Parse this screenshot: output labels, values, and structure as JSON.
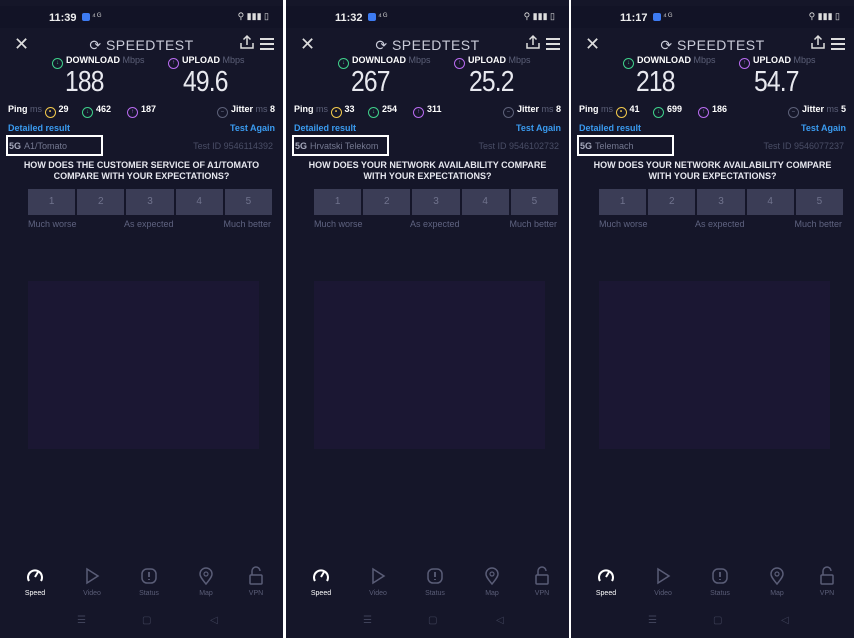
{
  "app": {
    "name": "SPEEDTEST"
  },
  "labels": {
    "download": "DOWNLOAD",
    "upload": "UPLOAD",
    "mbps": "Mbps",
    "ping": "Ping",
    "ms": "ms",
    "jitter": "Jitter",
    "detailed": "Detailed result",
    "again": "Test Again",
    "network": "5G",
    "rating": [
      "1",
      "2",
      "3",
      "4",
      "5"
    ],
    "scale": [
      "Much worse",
      "As expected",
      "Much better"
    ]
  },
  "nav": [
    "Speed",
    "Video",
    "Status",
    "Map",
    "VPN"
  ],
  "screens": [
    {
      "time": "11:39",
      "download": "188",
      "upload": "49.6",
      "ping": "29",
      "ping_dl": "462",
      "ping_ul": "187",
      "jitter": "8",
      "provider": "A1/Tomato",
      "test_id": "Test ID 9546114392",
      "question": "HOW DOES THE CUSTOMER SERVICE OF A1/TOMATO COMPARE WITH YOUR EXPECTATIONS?"
    },
    {
      "time": "11:32",
      "download": "267",
      "upload": "25.2",
      "ping": "33",
      "ping_dl": "254",
      "ping_ul": "311",
      "jitter": "8",
      "provider": "Hrvatski Telekom",
      "test_id": "Test ID 9546102732",
      "question": "HOW DOES YOUR NETWORK AVAILABILITY COMPARE WITH YOUR EXPECTATIONS?"
    },
    {
      "time": "11:17",
      "download": "218",
      "upload": "54.7",
      "ping": "41",
      "ping_dl": "699",
      "ping_ul": "186",
      "jitter": "5",
      "provider": "Telemach",
      "test_id": "Test ID 9546077237",
      "question": "HOW DOES YOUR NETWORK AVAILABILITY COMPARE WITH YOUR EXPECTATIONS?"
    }
  ],
  "colors": {
    "background": "#151629",
    "accent_link": "#3a9bf0",
    "download_icon": "#3fd08a",
    "upload_icon": "#b86bf0",
    "ping_icon": "#f2c94c"
  }
}
